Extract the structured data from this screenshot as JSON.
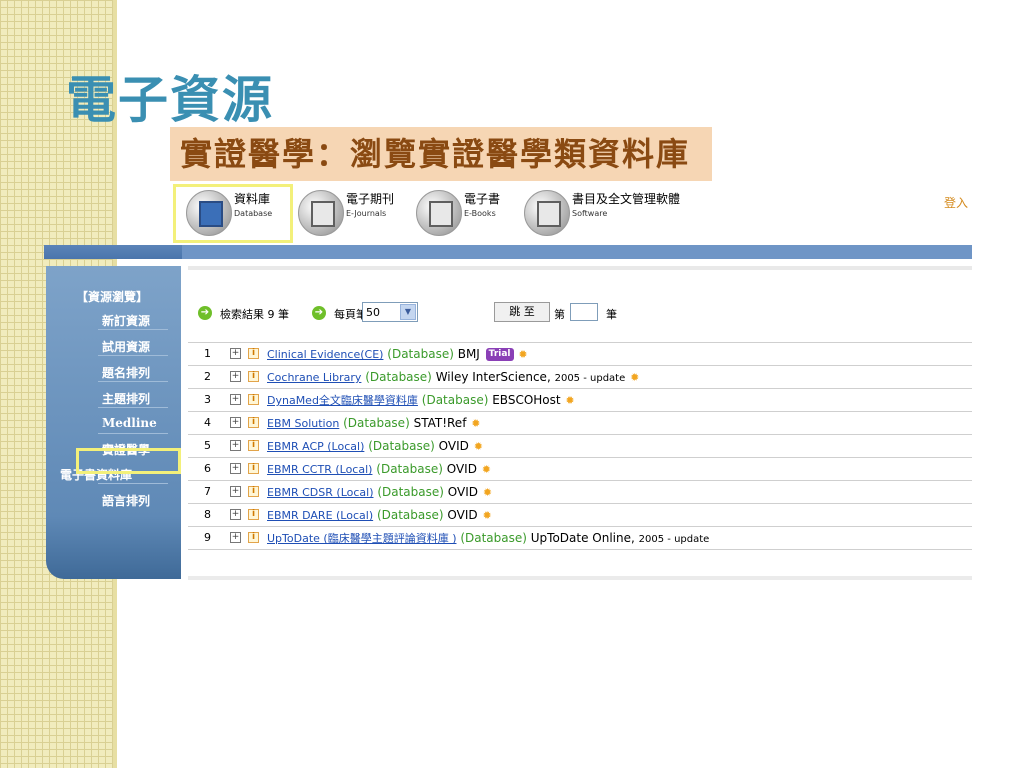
{
  "slide": {
    "title": "電子資源",
    "subtitle": "實證醫學：瀏覽實證醫學類資料庫"
  },
  "nav": {
    "items": [
      {
        "zh": "資料庫",
        "en": "Database",
        "icon": "database-icon"
      },
      {
        "zh": "電子期刊",
        "en": "E-Journals",
        "icon": "ejournal-icon"
      },
      {
        "zh": "電子書",
        "en": "E-Books",
        "icon": "ebook-icon"
      },
      {
        "zh": "書目及全文管理軟體",
        "en": "Software",
        "icon": "software-icon"
      }
    ],
    "login": "登入"
  },
  "sidebar": {
    "heading": "【資源瀏覽】",
    "items": [
      {
        "label": "新訂資源"
      },
      {
        "label": "試用資源"
      },
      {
        "label": "題名排列"
      },
      {
        "label": "主題排列"
      },
      {
        "label": "Medline"
      },
      {
        "label": "實證醫學"
      },
      {
        "label": "電子書資料庫"
      },
      {
        "label": "語言排列"
      }
    ]
  },
  "controls": {
    "result_count": "檢索結果 9 筆",
    "per_page_label": "每頁筆數",
    "per_page_value": "50",
    "jump_button": "跳 至",
    "page_prefix": "第",
    "page_suffix": "筆"
  },
  "results": [
    {
      "num": "1",
      "name": "Clinical Evidence(CE)",
      "type": "(Database)",
      "publisher": "BMJ",
      "note": "",
      "trial": "Trial",
      "lamp": true
    },
    {
      "num": "2",
      "name": "Cochrane Library",
      "type": "(Database)",
      "publisher": "Wiley InterScience,",
      "note": "2005 - update",
      "trial": "",
      "lamp": true
    },
    {
      "num": "3",
      "name": "DynaMed全文臨床醫學資料庫",
      "type": "(Database)",
      "publisher": "EBSCOHost",
      "note": "",
      "trial": "",
      "lamp": true
    },
    {
      "num": "4",
      "name": "EBM Solution",
      "type": "(Database)",
      "publisher": "STAT!Ref",
      "note": "",
      "trial": "",
      "lamp": true
    },
    {
      "num": "5",
      "name": "EBMR ACP (Local)",
      "type": "(Database)",
      "publisher": "OVID",
      "note": "",
      "trial": "",
      "lamp": true
    },
    {
      "num": "6",
      "name": "EBMR CCTR (Local)",
      "type": "(Database)",
      "publisher": "OVID",
      "note": "",
      "trial": "",
      "lamp": true
    },
    {
      "num": "7",
      "name": "EBMR CDSR (Local)",
      "type": "(Database)",
      "publisher": "OVID",
      "note": "",
      "trial": "",
      "lamp": true
    },
    {
      "num": "8",
      "name": "EBMR DARE (Local)",
      "type": "(Database)",
      "publisher": "OVID",
      "note": "",
      "trial": "",
      "lamp": true
    },
    {
      "num": "9",
      "name": "UpToDate (臨床醫學主題評論資料庫 )",
      "type": "(Database)",
      "publisher": "UpToDate Online,",
      "note": "2005 - update",
      "trial": "",
      "lamp": false
    }
  ],
  "colors": {
    "title": "#3a8fb2",
    "subtitle_bg": "#f6d6b4",
    "subtitle_text": "#8a4a12",
    "highlight": "#f3f07a",
    "link": "#1f4fb5",
    "type": "#3a9a2a",
    "sidebar": "#6f95c0",
    "trial": "#8a3fb6"
  }
}
